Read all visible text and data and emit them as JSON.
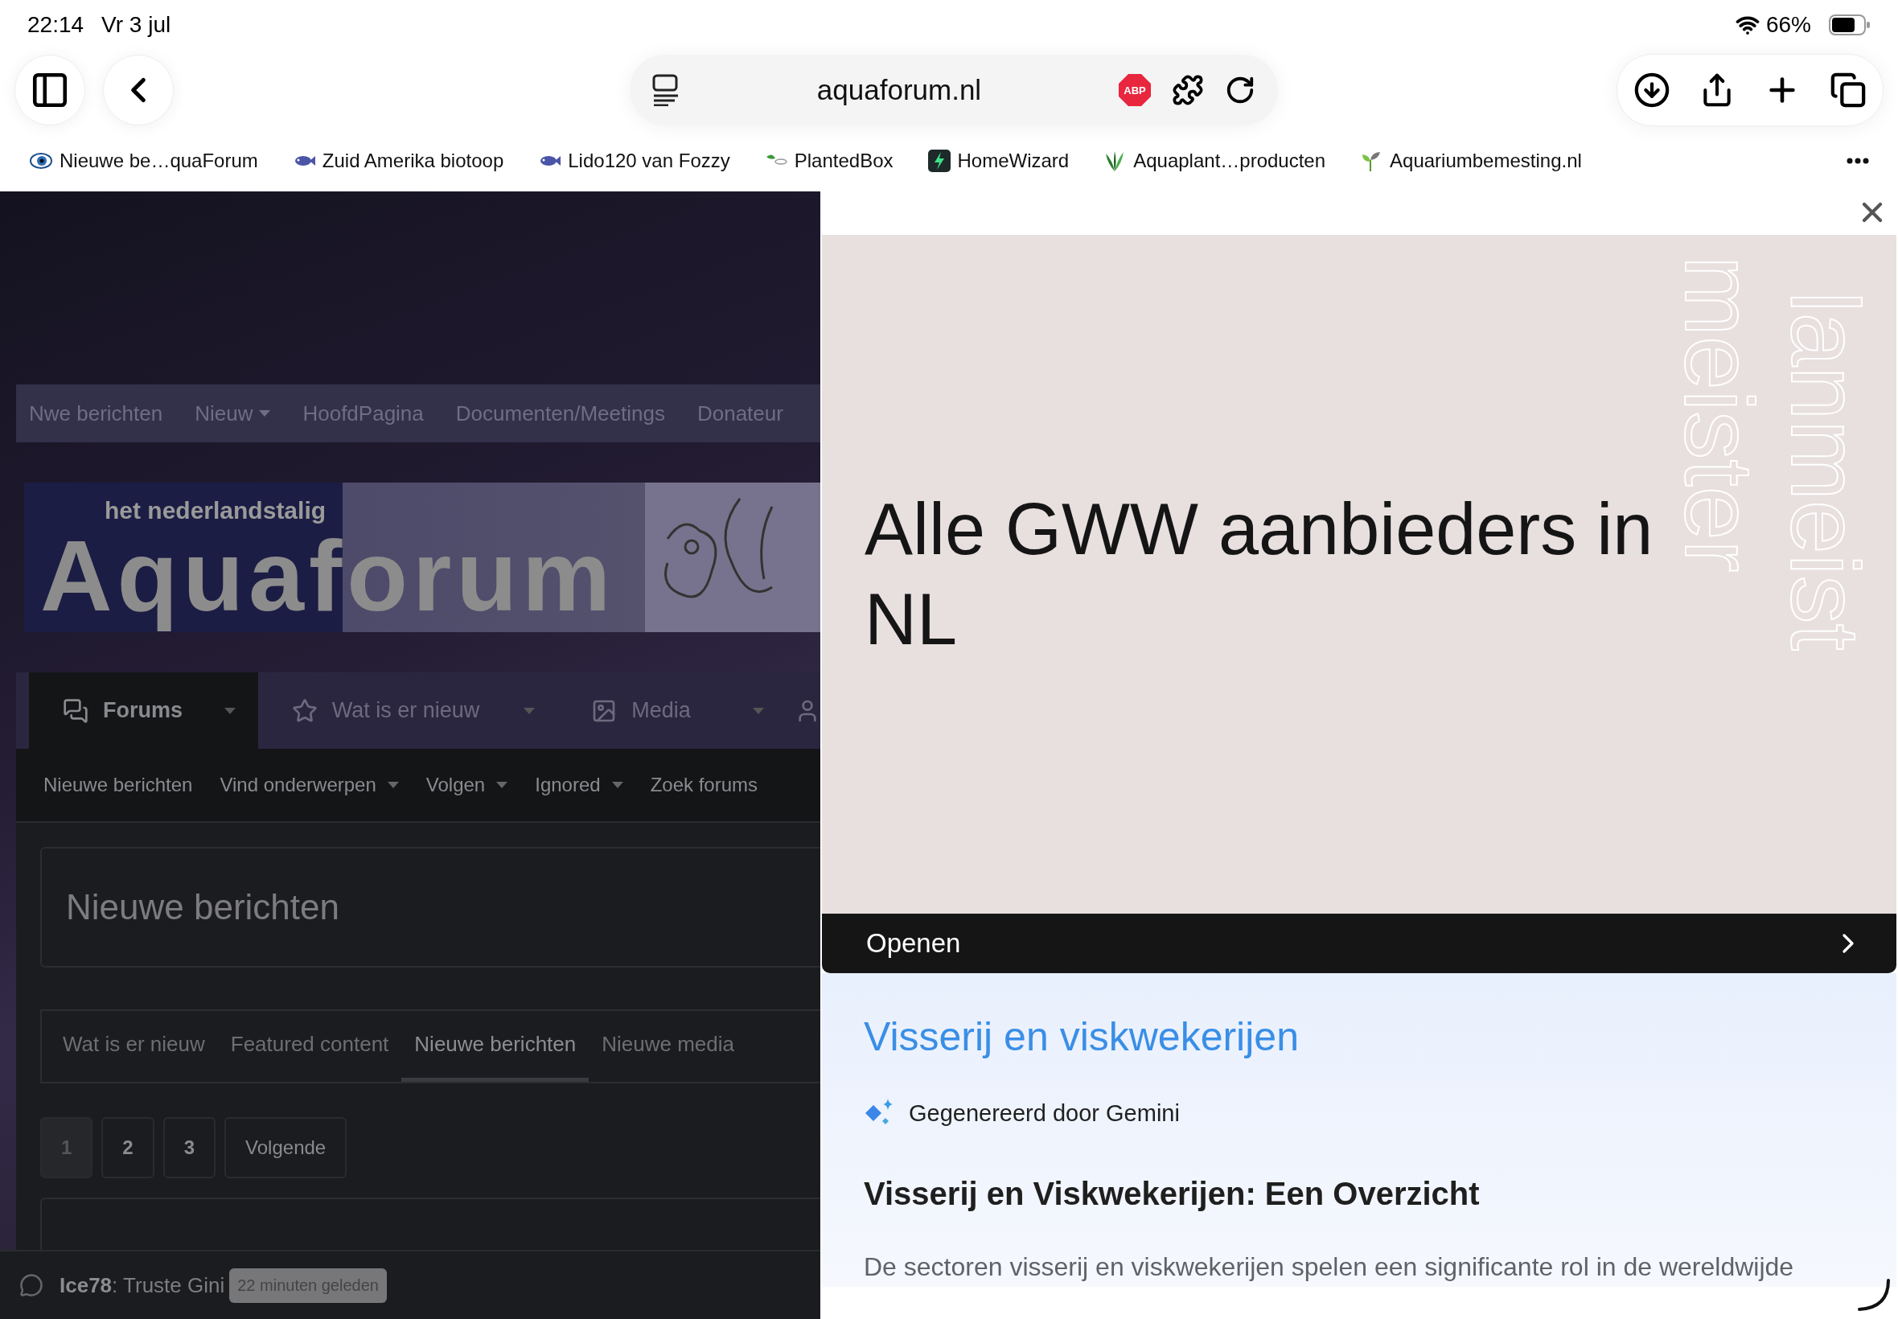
{
  "status_bar": {
    "time": "22:14",
    "date": "Vr 3 jul",
    "battery": "66%"
  },
  "toolbar": {
    "url": "aquaforum.nl",
    "adblock_badge": "ABP"
  },
  "bookmarks": [
    {
      "label": "Nieuwe be…quaForum"
    },
    {
      "label": "Zuid Amerika biotoop"
    },
    {
      "label": "Lido120 van Fozzy"
    },
    {
      "label": "PlantedBox"
    },
    {
      "label": "HomeWizard"
    },
    {
      "label": "Aquaplant…producten"
    },
    {
      "label": "Aquariumbemesting.nl"
    }
  ],
  "forum": {
    "top_nav": [
      {
        "label": "Nwe berichten",
        "dropdown": false
      },
      {
        "label": "Nieuw",
        "dropdown": true
      },
      {
        "label": "HoofdPagina",
        "dropdown": false
      },
      {
        "label": "Documenten/Meetings",
        "dropdown": false
      },
      {
        "label": "Donateur",
        "dropdown": false
      }
    ],
    "logo": {
      "tagline": "het nederlandstalig",
      "name": "Aquaforum"
    },
    "main_tabs": [
      {
        "label": "Forums",
        "selected": true
      },
      {
        "label": "Wat is er nieuw",
        "selected": false
      },
      {
        "label": "Media",
        "selected": false
      }
    ],
    "sub_nav": [
      {
        "label": "Nieuwe berichten",
        "dropdown": false
      },
      {
        "label": "Vind onderwerpen",
        "dropdown": true
      },
      {
        "label": "Volgen",
        "dropdown": true
      },
      {
        "label": "Ignored",
        "dropdown": true
      },
      {
        "label": "Zoek forums",
        "dropdown": false
      }
    ],
    "page_title": "Nieuwe berichten",
    "content_tabs": [
      {
        "label": "Wat is er nieuw",
        "selected": false
      },
      {
        "label": "Featured content",
        "selected": false
      },
      {
        "label": "Nieuwe berichten",
        "selected": true
      },
      {
        "label": "Nieuwe media",
        "selected": false
      }
    ],
    "pagination": [
      {
        "label": "1",
        "selected": true
      },
      {
        "label": "2",
        "selected": false
      },
      {
        "label": "3",
        "selected": false
      },
      {
        "label": "Volgende",
        "selected": false
      }
    ],
    "chat": {
      "user": "Ice78",
      "message": ": Truste Gini",
      "time": "22 minuten geleden"
    }
  },
  "panel": {
    "card": {
      "headline": "Alle GWW aanbieders in NL",
      "watermark": [
        "lanmeist",
        "meister"
      ]
    },
    "open_label": "Openen",
    "result_title": "Visserij en viskwekerijen",
    "gemini_label": "Gegenereerd door Gemini",
    "summary_heading": "Visserij en Viskwekerijen: Een Overzicht",
    "summary_text": "De sectoren visserij en viskwekerijen spelen een significante rol in de wereldwijde"
  }
}
